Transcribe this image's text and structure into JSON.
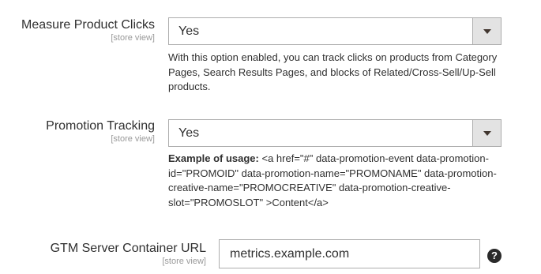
{
  "fields": [
    {
      "label": "Measure Product Clicks",
      "scope": "[store view]",
      "value": "Yes",
      "note": "With this option enabled, you can track clicks on products from Category Pages, Search Results Pages, and blocks of Related/Cross-Sell/Up-Sell products."
    },
    {
      "label": "Promotion Tracking",
      "scope": "[store view]",
      "value": "Yes",
      "note_bold": "Example of usage:",
      "note": "<a href=\"#\" data-promotion-event data-promotion-id=\"PROMOID\" data-promotion-name=\"PROMONAME\" data-promotion-creative-name=\"PROMOCREATIVE\" data-promotion-creative-slot=\"PROMOSLOT\" >Content</a>"
    },
    {
      "label": "GTM Server Container URL",
      "scope": "[store view]",
      "value": "metrics.example.com",
      "help_icon": "?"
    }
  ],
  "icons": {
    "dropdown": "chevron-down-icon",
    "help": "help-icon"
  }
}
